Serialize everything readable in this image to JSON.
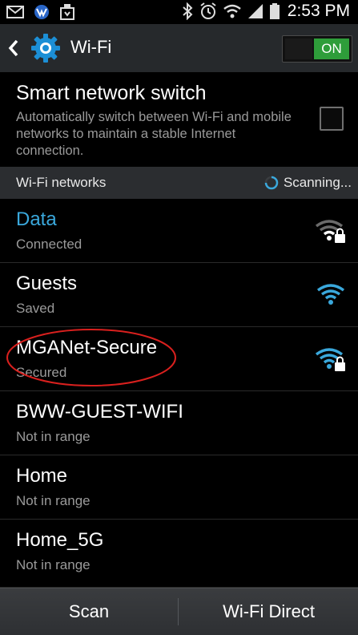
{
  "status_bar": {
    "time": "2:53 PM",
    "icons": [
      "mail-icon",
      "voicemail-icon",
      "download-icon",
      "bluetooth-icon",
      "alarm-icon",
      "wifi-status-icon",
      "signal-icon",
      "battery-icon"
    ]
  },
  "action_bar": {
    "title": "Wi-Fi",
    "toggle_label": "ON"
  },
  "smart_switch": {
    "title": "Smart network switch",
    "description": "Automatically switch between Wi-Fi and mobile networks to maintain a stable Internet connection.",
    "checked": false
  },
  "networks_header": {
    "label": "Wi-Fi networks",
    "scanning_label": "Scanning..."
  },
  "networks": [
    {
      "name": "Data",
      "status": "Connected"
    },
    {
      "name": "Guests",
      "status": "Saved"
    },
    {
      "name": "MGANet-Secure",
      "status": "Secured"
    },
    {
      "name": "BWW-GUEST-WIFI",
      "status": "Not in range"
    },
    {
      "name": "Home",
      "status": "Not in range"
    },
    {
      "name": "Home_5G",
      "status": "Not in range"
    }
  ],
  "bottom_bar": {
    "scan_label": "Scan",
    "wifi_direct_label": "Wi-Fi Direct"
  },
  "colors": {
    "accent_blue": "#3aa8dc",
    "toggle_green": "#2e9d3a",
    "highlight_red": "#d9201e"
  }
}
